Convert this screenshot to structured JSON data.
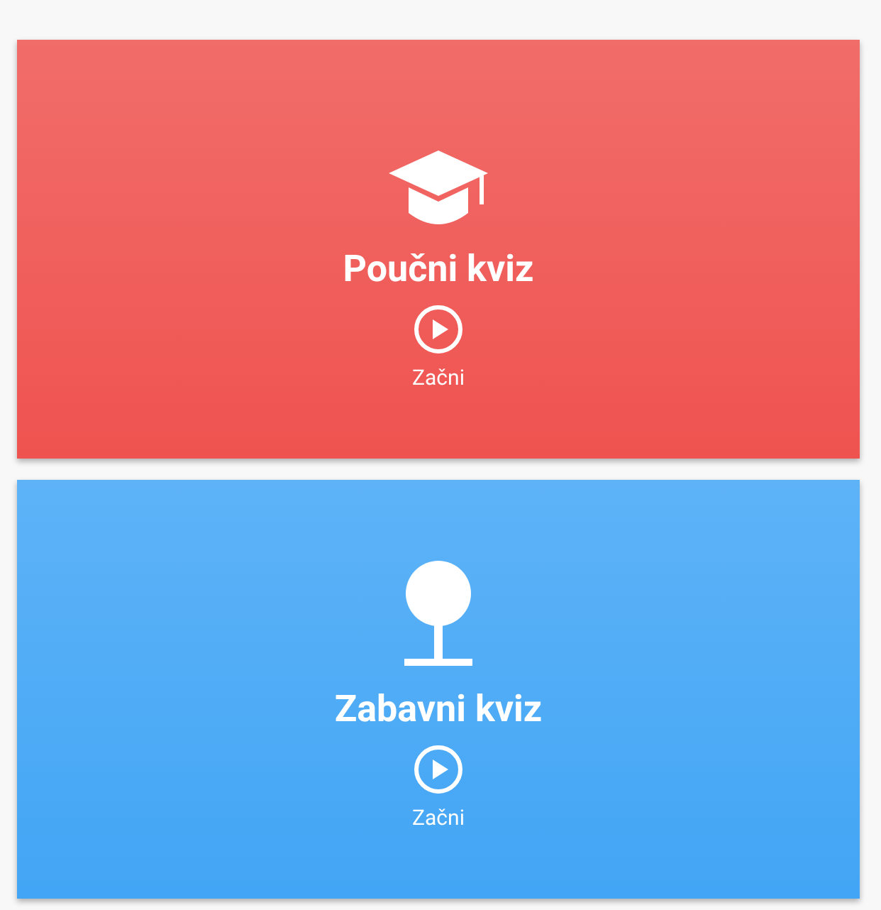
{
  "cards": [
    {
      "kind": "cap",
      "color": "#ef5350",
      "title": "Poučni kviz",
      "action": "Začni"
    },
    {
      "kind": "ball",
      "color": "#42a5f5",
      "title": "Zabavni kviz",
      "action": "Začni"
    }
  ]
}
